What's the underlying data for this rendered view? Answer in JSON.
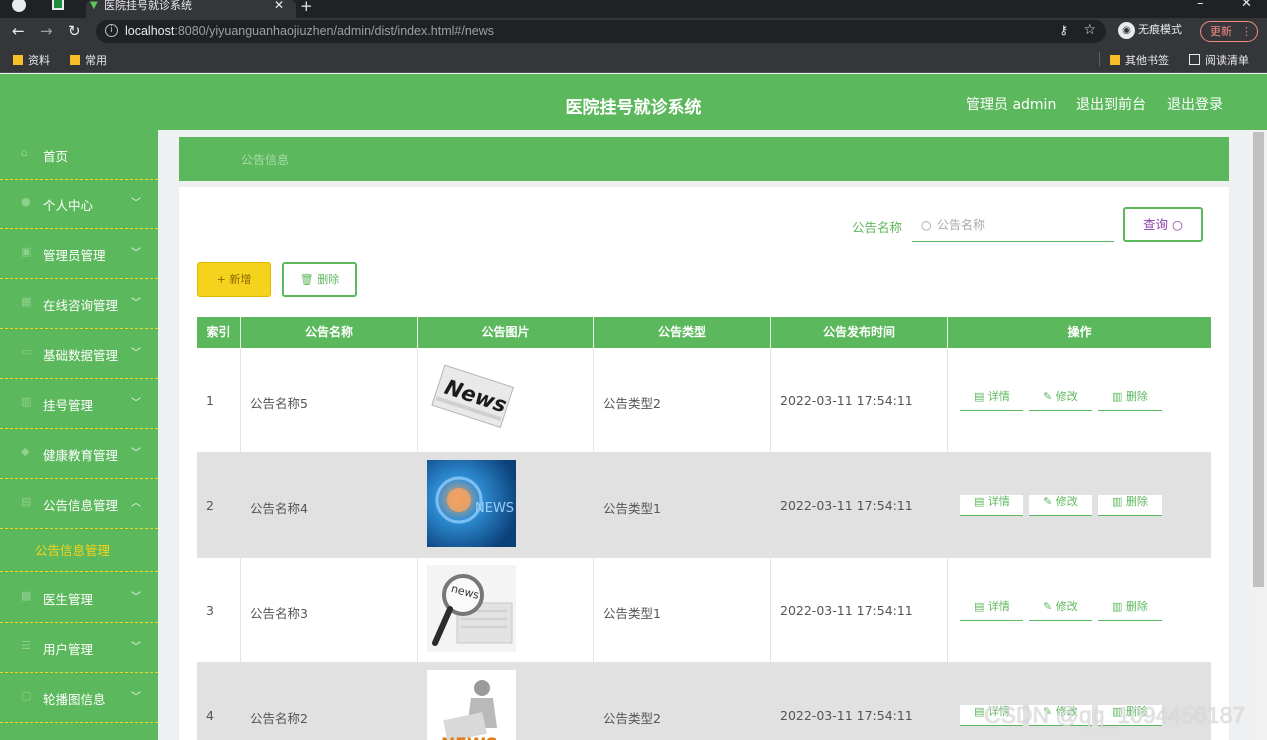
{
  "browser": {
    "tab_title": "医院挂号就诊系统",
    "url_host": "localhost",
    "url_rest": ":8080/yiyuanguanhaojiuzhen/admin/dist/index.html#/news",
    "incognito_label": "无痕模式",
    "update_label": "更新",
    "bookmarks": [
      "资料",
      "常用"
    ],
    "other_bookmarks": "其他书签",
    "reading_list": "阅读清单"
  },
  "header": {
    "title": "医院挂号就诊系统",
    "admin_label": "管理员 admin",
    "front_link": "退出到前台",
    "logout_link": "退出登录"
  },
  "sidebar": {
    "items": [
      {
        "label": "首页",
        "icon": "home-icon"
      },
      {
        "label": "个人中心",
        "icon": "user-icon"
      },
      {
        "label": "管理员管理",
        "icon": "admin-icon"
      },
      {
        "label": "在线咨询管理",
        "icon": "chat-icon"
      },
      {
        "label": "基础数据管理",
        "icon": "data-icon"
      },
      {
        "label": "挂号管理",
        "icon": "chart-icon"
      },
      {
        "label": "健康教育管理",
        "icon": "book-icon"
      },
      {
        "label": "公告信息管理",
        "icon": "notice-icon"
      },
      {
        "label": "医生管理",
        "icon": "doctor-icon"
      },
      {
        "label": "用户管理",
        "icon": "users-icon"
      },
      {
        "label": "轮播图信息",
        "icon": "image-icon"
      }
    ],
    "active_sub": "公告信息管理"
  },
  "breadcrumb": "公告信息",
  "search": {
    "label": "公告名称",
    "placeholder": "公告名称",
    "button": "查询"
  },
  "actions": {
    "add": "+ 新增",
    "delete": "删除"
  },
  "table": {
    "columns": [
      "索引",
      "公告名称",
      "公告图片",
      "公告类型",
      "公告发布时间",
      "操作"
    ],
    "rows": [
      {
        "index": "1",
        "name": "公告名称5",
        "type": "公告类型2",
        "time": "2022-03-11 17:54:11"
      },
      {
        "index": "2",
        "name": "公告名称4",
        "type": "公告类型1",
        "time": "2022-03-11 17:54:11"
      },
      {
        "index": "3",
        "name": "公告名称3",
        "type": "公告类型1",
        "time": "2022-03-11 17:54:11"
      },
      {
        "index": "4",
        "name": "公告名称2",
        "type": "公告类型2",
        "time": "2022-03-11 17:54:11"
      }
    ],
    "op_detail": "详情",
    "op_edit": "修改",
    "op_delete": "删除"
  },
  "watermark": "CSDN @qq_1094456187",
  "colors": {
    "brand_green": "#5cb85c",
    "accent_yellow": "#f5d31c"
  }
}
